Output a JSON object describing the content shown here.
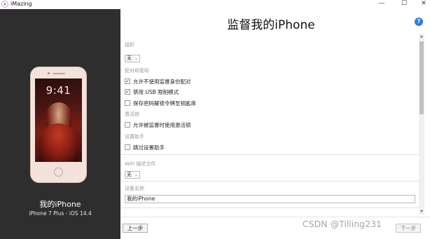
{
  "window": {
    "title": "iMazing",
    "minimize_glyph": "—",
    "maximize_glyph": "☐",
    "close_glyph": "✕"
  },
  "device": {
    "lock_time": "9:41",
    "name": "我的iPhone",
    "model": "iPhone 7 Plus - iOS 14.4"
  },
  "page": {
    "heading": "监督我的iPhone",
    "help_glyph": "?"
  },
  "form": {
    "org_label": "组织",
    "org_value": "无",
    "pairing_label": "配对和密码",
    "pairing_options": [
      {
        "label": "允许不使用监督身份配对",
        "checked": true
      },
      {
        "label": "禁用 USB 限制模式",
        "checked": true
      },
      {
        "label": "保存密码解锁令牌至钥匙串",
        "checked": false
      }
    ],
    "activation_label": "激活锁",
    "activation_option": {
      "label": "允许被监督时使用激活锁",
      "checked": false
    },
    "setup_label": "设置助手",
    "setup_option": {
      "label": "跳过设置助手",
      "checked": false
    },
    "wifi_label": "WiFi 描述文件",
    "wifi_value": "无",
    "device_name_label": "设备名称",
    "device_name_value": "我的iPhone",
    "dropdown_arrow": "⌄",
    "check_glyph": "✓"
  },
  "footer": {
    "back_label": "上一步",
    "next_label": "下一步"
  },
  "watermark": "CSDN @Tilling231",
  "colors": {
    "sidebar_bg": "#2e2e2e",
    "help_blue": "#2f7de1",
    "section_label": "#9a9a9a"
  }
}
